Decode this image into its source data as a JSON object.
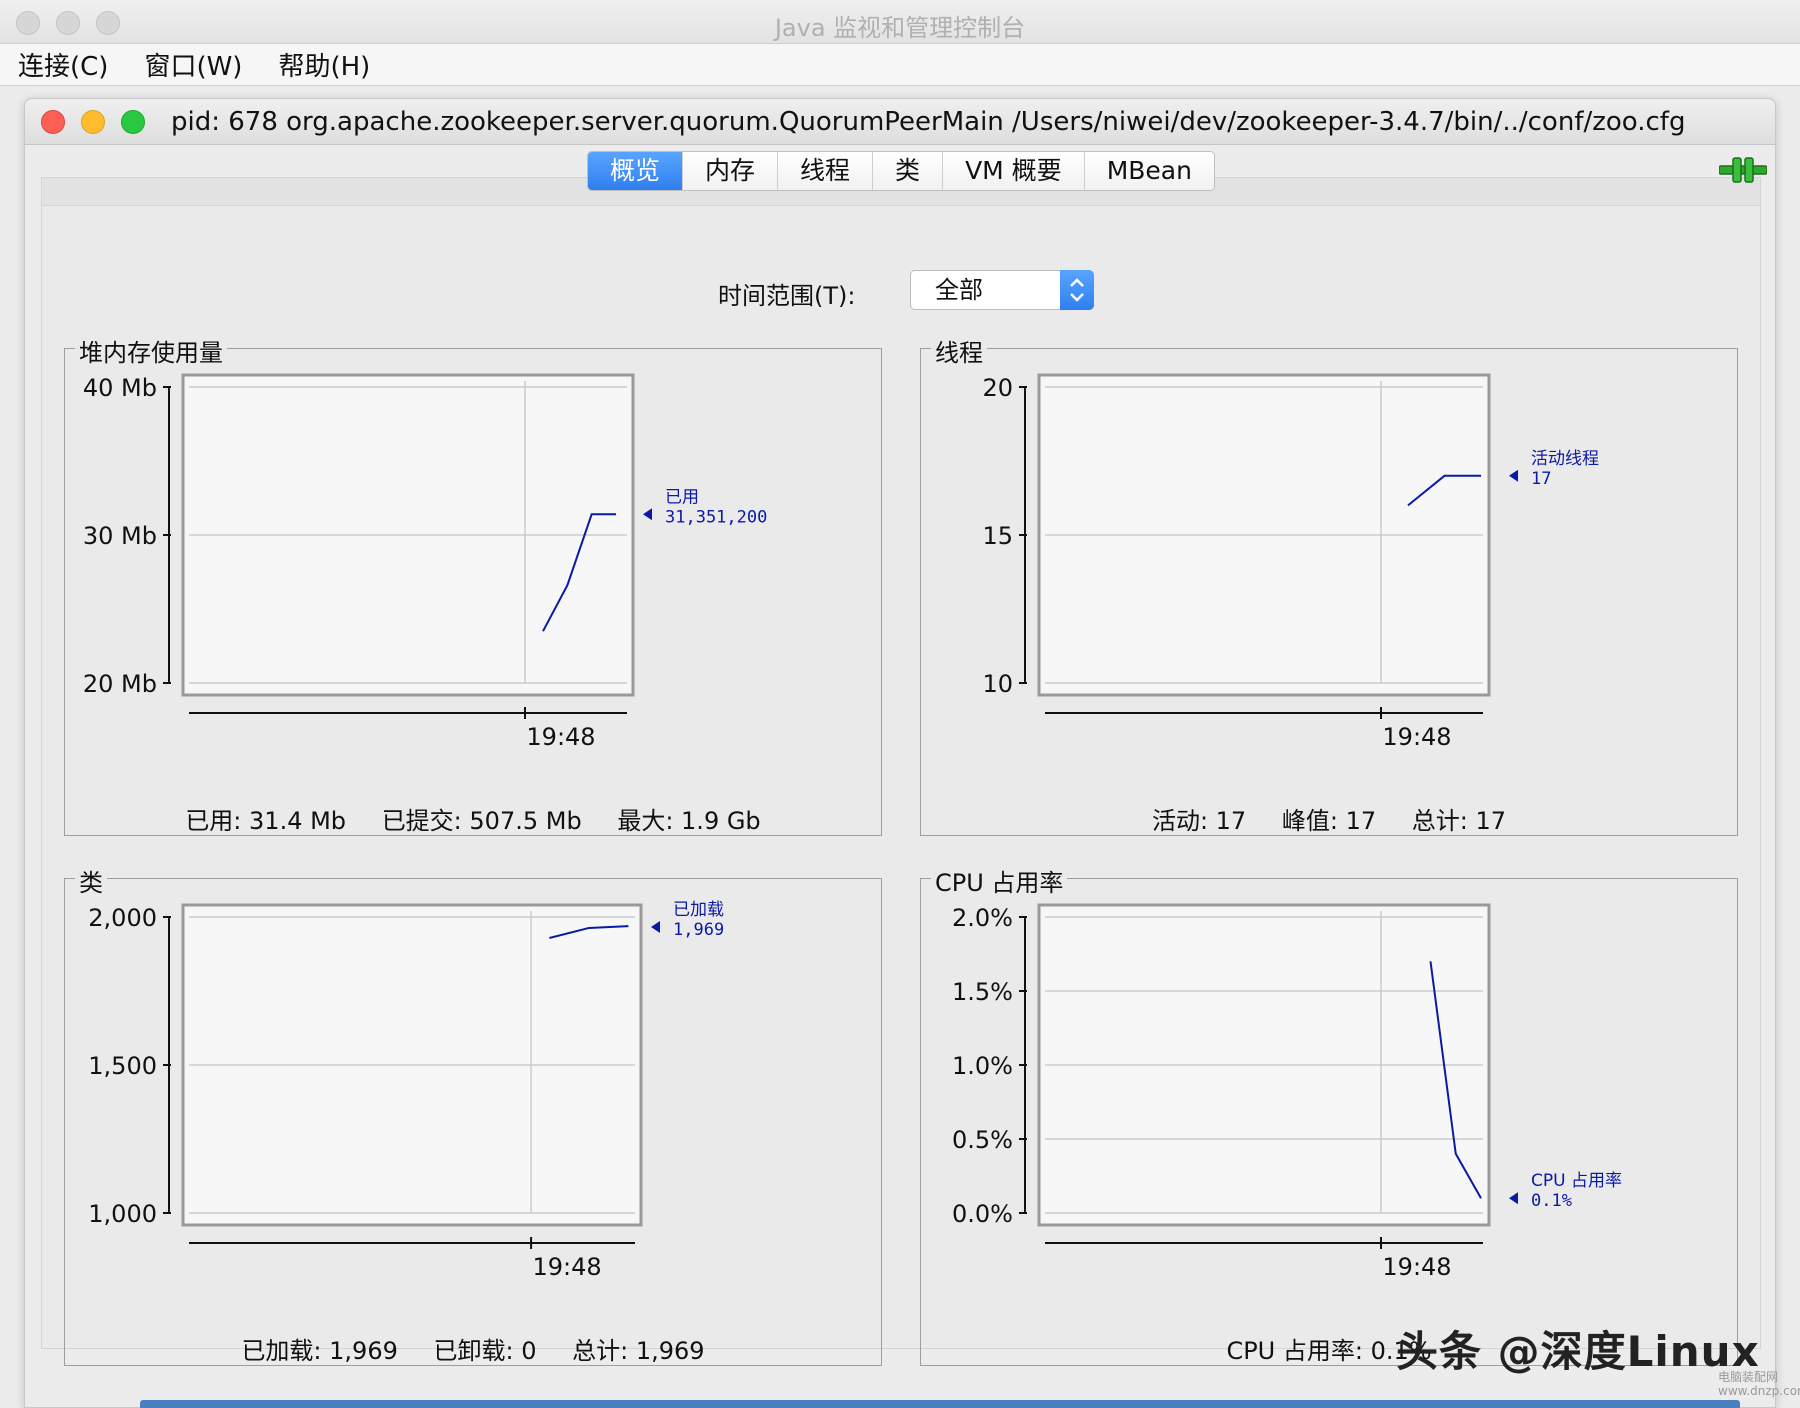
{
  "os_window": {
    "title": "Java 监视和管理控制台"
  },
  "menu": {
    "items": [
      "连接(C)",
      "窗口(W)",
      "帮助(H)"
    ]
  },
  "inner_window": {
    "title": "pid: 678 org.apache.zookeeper.server.quorum.QuorumPeerMain /Users/niwei/dev/zookeeper-3.4.7/bin/../conf/zoo.cfg"
  },
  "tabs": [
    {
      "label": "概览",
      "active": true
    },
    {
      "label": "内存",
      "active": false
    },
    {
      "label": "线程",
      "active": false
    },
    {
      "label": "类",
      "active": false
    },
    {
      "label": "VM 概要",
      "active": false
    },
    {
      "label": "MBean",
      "active": false
    }
  ],
  "time_range": {
    "label": "时间范围(T):",
    "value": "全部"
  },
  "colors": {
    "series": "#0a1aa8",
    "accent": "#2f7ff0",
    "grid": "#cccccc"
  },
  "icons": {
    "connection": "connection-plug-icon"
  },
  "chart_data": [
    {
      "id": "heap",
      "type": "line",
      "title": "堆内存使用量",
      "y_ticks": [
        "40 Mb",
        "30 Mb",
        "20 Mb"
      ],
      "ylim": [
        20,
        40
      ],
      "x_tick_label": "19:48",
      "series": [
        {
          "name": "已用",
          "values": [
            23.5,
            26.6,
            31.4,
            31.4
          ]
        }
      ],
      "latest_label": "已用",
      "latest_value": "31,351,200",
      "stats": [
        "已用: 31.4 Mb",
        "已提交: 507.5 Mb",
        "最大: 1.9 Gb"
      ]
    },
    {
      "id": "threads",
      "type": "line",
      "title": "线程",
      "y_ticks": [
        "20",
        "15",
        "10"
      ],
      "ylim": [
        10,
        20
      ],
      "x_tick_label": "19:48",
      "series": [
        {
          "name": "活动线程",
          "values": [
            16,
            17,
            17
          ]
        }
      ],
      "latest_label": "活动线程",
      "latest_value": "17",
      "stats": [
        "活动: 17",
        "峰值: 17",
        "总计: 17"
      ]
    },
    {
      "id": "classes",
      "type": "line",
      "title": "类",
      "y_ticks": [
        "2,000",
        "1,500",
        "1,000"
      ],
      "ylim": [
        1000,
        2000
      ],
      "x_tick_label": "19:48",
      "series": [
        {
          "name": "已加载",
          "values": [
            1929,
            1963,
            1969
          ]
        }
      ],
      "latest_label": "已加载",
      "latest_value": "1,969",
      "stats": [
        "已加载: 1,969",
        "已卸载: 0",
        "总计: 1,969"
      ]
    },
    {
      "id": "cpu",
      "type": "line",
      "title": "CPU 占用率",
      "y_ticks": [
        "2.0%",
        "1.5%",
        "1.0%",
        "0.5%",
        "0.0%"
      ],
      "ylim": [
        0,
        2
      ],
      "x_tick_label": "19:48",
      "series": [
        {
          "name": "CPU 占用率",
          "values": [
            1.7,
            0.4,
            0.1
          ]
        }
      ],
      "latest_label": "CPU 占用率",
      "latest_value": "0.1%",
      "stats": [
        "CPU 占用率: 0.1%"
      ]
    }
  ],
  "watermark": {
    "text": "头条 @深度Linux",
    "small": "电脑装配网 www.dnzp.com"
  }
}
